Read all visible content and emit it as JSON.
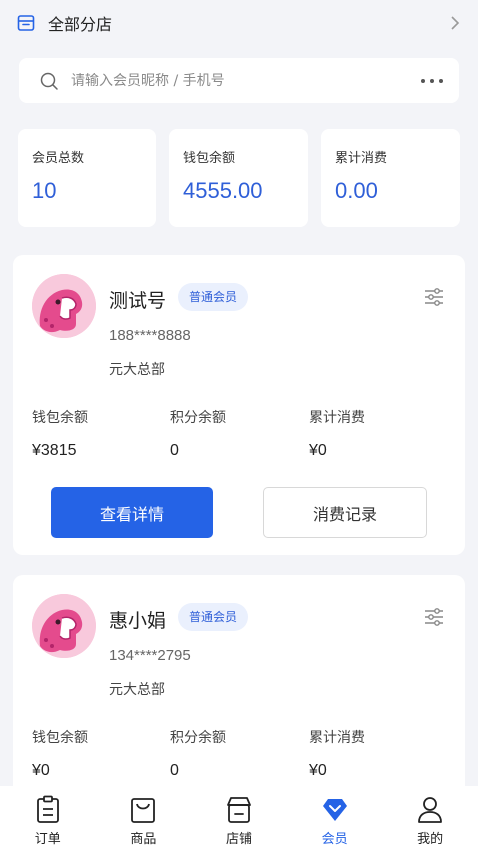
{
  "store": {
    "label": "全部分店"
  },
  "search": {
    "placeholder": "请输入会员昵称 / 手机号"
  },
  "stats": [
    {
      "label": "会员总数",
      "value": "10"
    },
    {
      "label": "钱包余额",
      "value": "4555.00"
    },
    {
      "label": "累计消费",
      "value": "0.00"
    }
  ],
  "members": [
    {
      "name": "测试号",
      "level": "普通会员",
      "phone": "188****8888",
      "branch": "元大总部",
      "columns": [
        {
          "label": "钱包余额",
          "value": "¥3815"
        },
        {
          "label": "积分余额",
          "value": "0"
        },
        {
          "label": "累计消费",
          "value": "¥0"
        }
      ],
      "detail_label": "查看详情",
      "records_label": "消费记录"
    },
    {
      "name": "惠小娟",
      "level": "普通会员",
      "phone": "134****2795",
      "branch": "元大总部",
      "columns": [
        {
          "label": "钱包余额",
          "value": "¥0"
        },
        {
          "label": "积分余额",
          "value": "0"
        },
        {
          "label": "累计消费",
          "value": "¥0"
        }
      ],
      "detail_label": "查看详情",
      "records_label": "消费记录"
    }
  ],
  "tabbar": [
    {
      "label": "订单",
      "icon": "order-icon"
    },
    {
      "label": "商品",
      "icon": "goods-icon"
    },
    {
      "label": "店铺",
      "icon": "store-icon"
    },
    {
      "label": "会员",
      "icon": "member-icon",
      "active": true
    },
    {
      "label": "我的",
      "icon": "profile-icon"
    }
  ],
  "colors": {
    "accent": "#2563e6",
    "badge_bg": "#eaf0fd",
    "background": "#f3f4f8"
  }
}
